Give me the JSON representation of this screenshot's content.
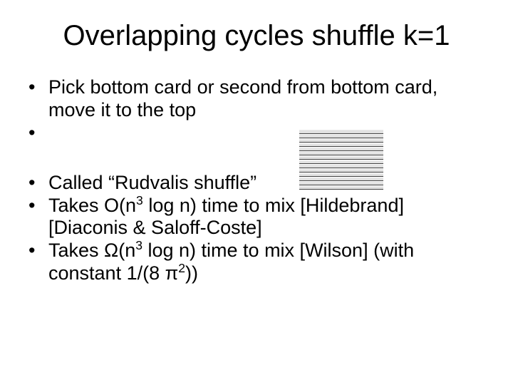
{
  "title": "Overlapping cycles shuffle k=1",
  "bullets": {
    "b1": "Pick bottom card or second from bottom card, move it to the top",
    "b2": "Called “Rudvalis shuffle”",
    "b3_pre": "Takes O(n",
    "b3_sup": "3",
    "b3_mid": " log n) time to mix [Hildebrand] [Diaconis & Saloff-Coste]",
    "b4_pre": "Takes Ω(n",
    "b4_sup": "3",
    "b4_mid": " log n) time to mix [Wilson] (with constant 1/(8 π",
    "b4_sup2": "2",
    "b4_end": "))"
  }
}
